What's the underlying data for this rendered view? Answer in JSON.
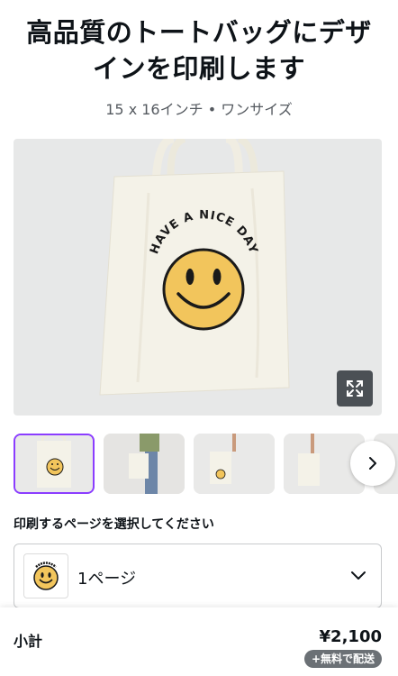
{
  "header": {
    "title": "高品質のトートバッグにデザインを印刷します",
    "subtitle": "15 x 16インチ • ワンサイズ"
  },
  "product": {
    "print_text": "HAVE A NICE DAY",
    "icons": {
      "expand": "expand-icon",
      "next": "chevron-right-icon",
      "dropdown": "chevron-down-icon"
    }
  },
  "gallery": {
    "thumbnails": [
      {
        "name": "front-view",
        "selected": true
      },
      {
        "name": "model-view",
        "selected": false
      },
      {
        "name": "held-view",
        "selected": false
      },
      {
        "name": "plain-view",
        "selected": false
      }
    ]
  },
  "page_selection": {
    "label": "印刷するページを選択してください",
    "selected_value": "1ページ"
  },
  "footer": {
    "subtotal_label": "小計",
    "price": "¥2,100",
    "shipping_badge": "+無料で配送"
  },
  "colors": {
    "accent": "#8b3dff",
    "tote": "#f4f2e8",
    "smiley": "#f2c55c",
    "text": "#0e1318"
  }
}
